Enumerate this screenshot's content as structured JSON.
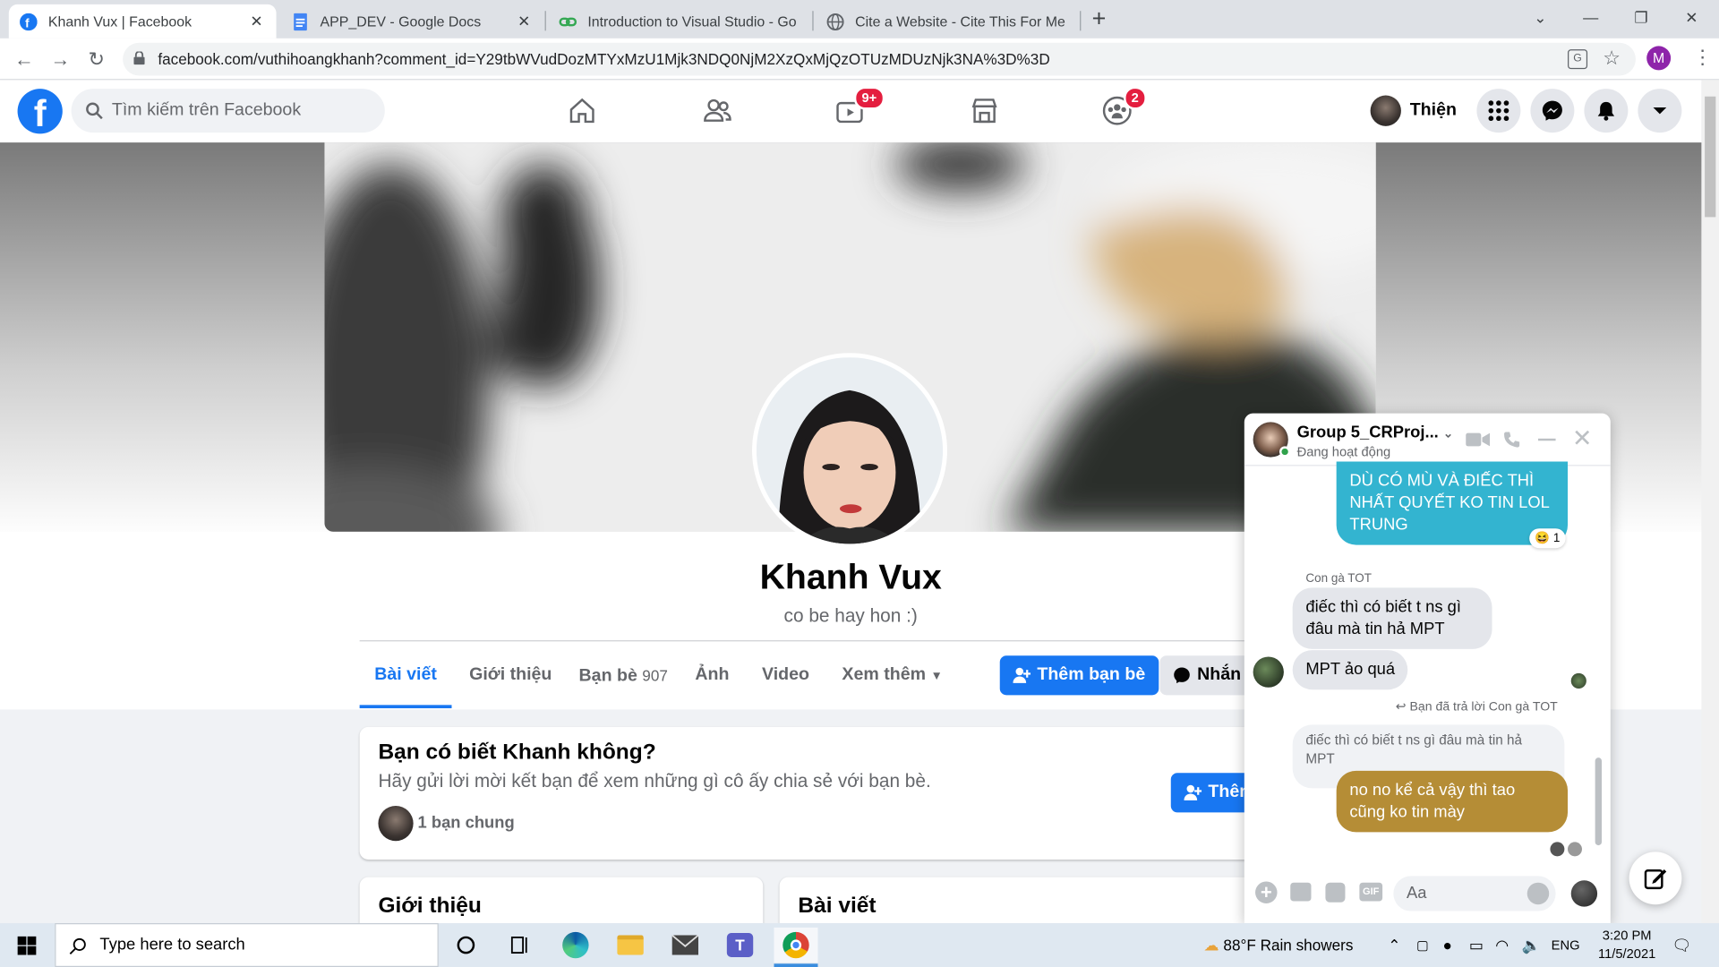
{
  "browser": {
    "tabs": [
      {
        "title": "Khanh Vux | Facebook",
        "active": true
      },
      {
        "title": "APP_DEV - Google Docs",
        "active": false
      },
      {
        "title": "Introduction to Visual Studio - Go",
        "active": false
      },
      {
        "title": "Cite a Website - Cite This For Me",
        "active": false
      }
    ],
    "url": "facebook.com/vuthihoangkhanh?comment_id=Y29tbWVudDozMTYxMzU1Mjk3NDQ0NjM2XzQxMjQzOTUzMDUzNjk3NA%3D%3D",
    "profile_initial": "M"
  },
  "fb": {
    "logo": "f",
    "search_placeholder": "Tìm kiếm trên Facebook",
    "watch_badge": "9+",
    "groups_badge": "2",
    "user_name": "Thiện"
  },
  "profile": {
    "name": "Khanh Vux",
    "bio": "co be hay hon :)",
    "tabs": [
      "Bài viết",
      "Giới thiệu",
      "Bạn bè",
      "Ảnh",
      "Video",
      "Xem thêm"
    ],
    "friends_count": "907",
    "add_friend": "Thêm bạn bè",
    "message": "Nhắn"
  },
  "suggest": {
    "title": "Bạn có biết Khanh không?",
    "subtitle": "Hãy gửi lời mời kết bạn để xem những gì cô ấy chia sẻ với bạn bè.",
    "mutual": "1 bạn chung",
    "button": "Thêm"
  },
  "sections": {
    "intro": "Giới thiệu",
    "posts": "Bài viết"
  },
  "chat": {
    "title": "Group 5_CRProj...",
    "status": "Đang hoạt động",
    "msg1": "DÙ CÓ MÙ VÀ ĐIẾC THÌ NHẤT QUYẾT KO TIN LOL TRUNG",
    "msg1_react_count": "1",
    "sender": "Con gà TOT",
    "msg2": "điếc thì có biết t ns gì đâu mà tin hả MPT",
    "msg3": "MPT ảo quá",
    "reply_note": "Bạn đã trả lời Con gà TOT",
    "quoted": "điếc thì có biết t ns gì đâu mà tin hả MPT",
    "msg4": "no no kể cả vậy thì tao cũng ko tin mày",
    "input_placeholder": "Aa"
  },
  "taskbar": {
    "search_placeholder": "Type here to search",
    "weather": "88°F  Rain showers",
    "lang": "ENG",
    "time": "3:20 PM",
    "date": "11/5/2021"
  }
}
